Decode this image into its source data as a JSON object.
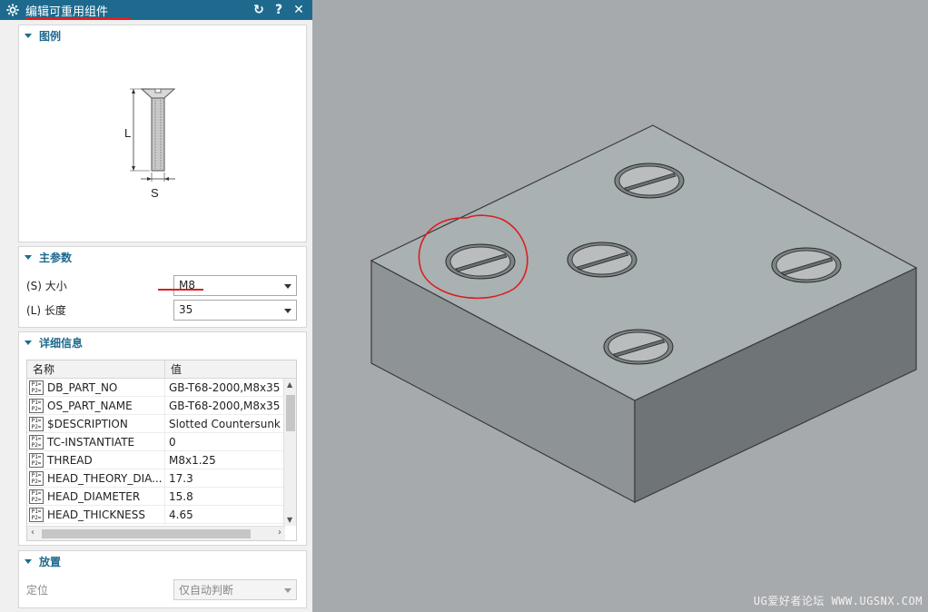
{
  "dialog": {
    "title": "编辑可重用组件",
    "buttons": {
      "reset": "↻",
      "help": "?",
      "close": "✕"
    }
  },
  "sections": {
    "legend": {
      "title": "图例",
      "dim_L": "L",
      "dim_S": "S"
    },
    "main_params": {
      "title": "主参数",
      "size_label": "(S) 大小",
      "size_value": "M8",
      "length_label": "(L) 长度",
      "length_value": "35"
    },
    "details": {
      "title": "详细信息",
      "columns": {
        "name": "名称",
        "value": "值"
      },
      "rows": [
        {
          "name": "DB_PART_NO",
          "value": "GB-T68-2000,M8x35"
        },
        {
          "name": "OS_PART_NAME",
          "value": "GB-T68-2000,M8x35"
        },
        {
          "name": "$DESCRIPTION",
          "value": "Slotted Countersunk H"
        },
        {
          "name": "TC-INSTANTIATE",
          "value": "0"
        },
        {
          "name": "THREAD",
          "value": "M8x1.25"
        },
        {
          "name": "HEAD_THEORY_DIA...",
          "value": "17.3"
        },
        {
          "name": "HEAD_DIAMETER",
          "value": "15.8"
        },
        {
          "name": "HEAD_THICKNESS",
          "value": "4.65"
        }
      ],
      "param_icon_text": [
        "P1=",
        "P2="
      ]
    },
    "placement": {
      "title": "放置",
      "position_label": "定位",
      "position_value": "仅自动判断"
    }
  },
  "watermark": "UG爱好者论坛 WWW.UGSNX.COM",
  "colors": {
    "title_bar": "#1e6a8e",
    "section_header": "#1e6a8e",
    "annotation_red": "#d82020",
    "viewport_bg": "#a7aaad"
  }
}
